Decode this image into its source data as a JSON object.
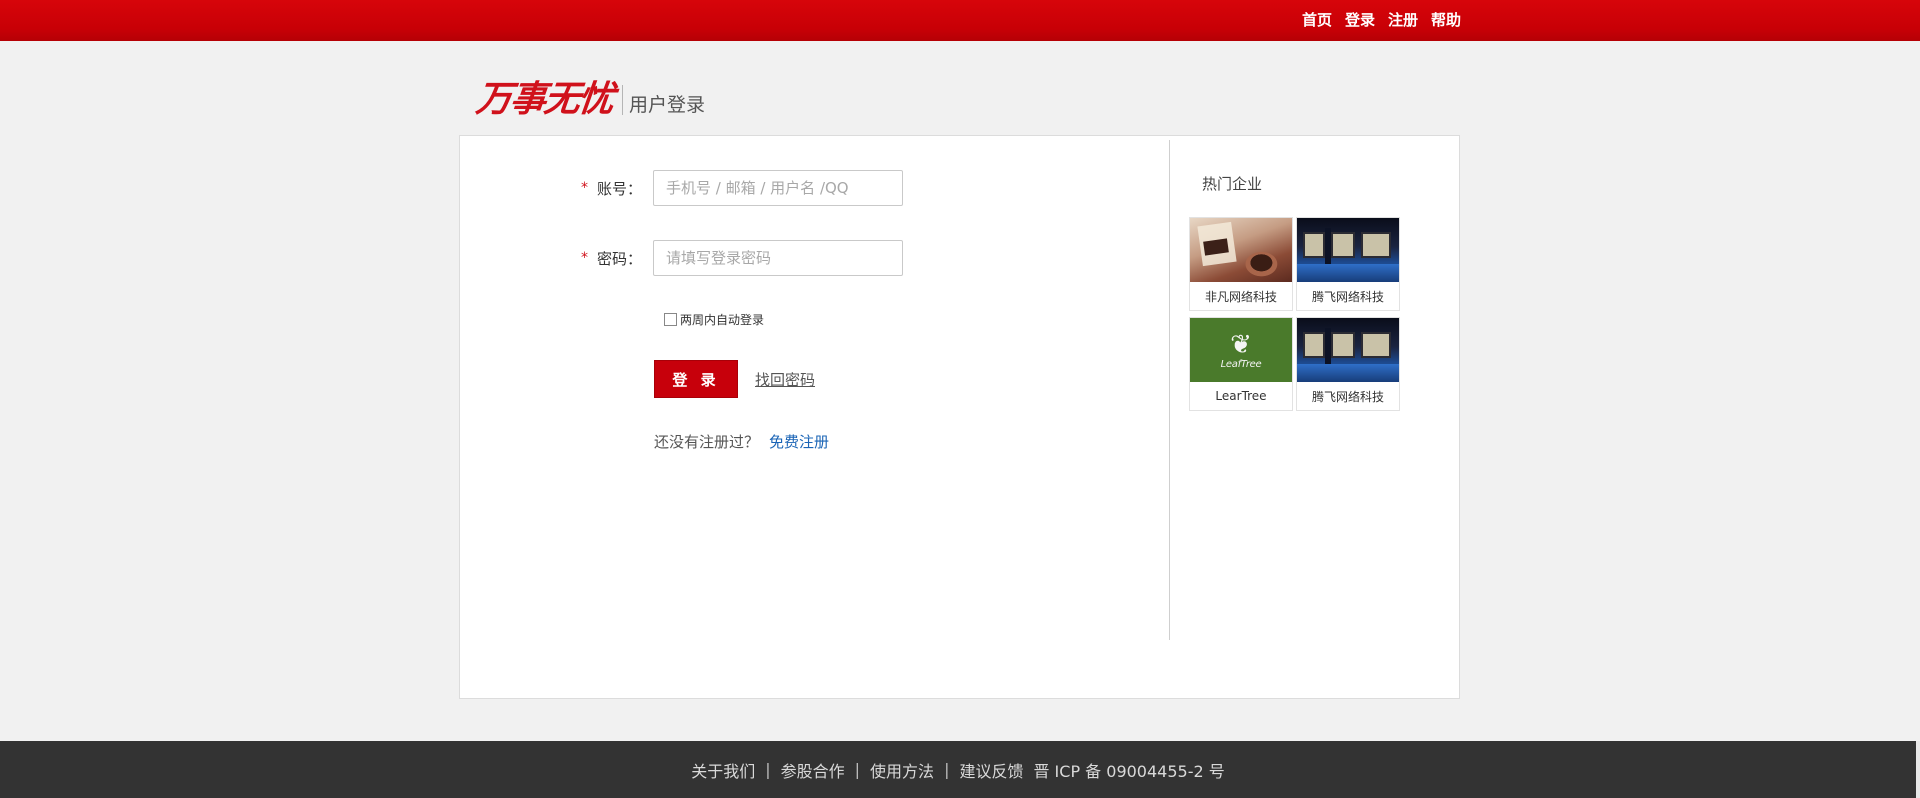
{
  "topnav": {
    "items": [
      "首页",
      "登录",
      "注册",
      "帮助"
    ]
  },
  "brand": {
    "logo_text": "万事无忧",
    "subtitle": "用户登录"
  },
  "login_form": {
    "account_label": "账号：",
    "account_placeholder": "手机号 / 邮箱 / 用户名 /QQ",
    "password_label": "密码：",
    "password_placeholder": "请填写登录密码",
    "required_mark": "*",
    "remember_label": "两周内自动登录",
    "remember_checked": false,
    "login_button": "登 录",
    "forgot_link": "找回密码",
    "register_prompt": "还没有注册过？",
    "register_link": "免费注册"
  },
  "hot_companies": {
    "title": "热门企业",
    "items": [
      {
        "name": "非凡网络科技",
        "thumb": "cafe-photo"
      },
      {
        "name": "腾飞网络科技",
        "thumb": "office-room-photo"
      },
      {
        "name": "LearTree",
        "thumb": "leaftree-logo",
        "logo_text": "LeafTree"
      },
      {
        "name": "腾飞网络科技",
        "thumb": "office-room-photo"
      }
    ]
  },
  "footer": {
    "links": [
      "关于我们",
      "参股合作",
      "使用方法",
      "建议反馈"
    ],
    "icp": "晋 ICP 备 09004455-2 号"
  },
  "colors": {
    "brand_red": "#c7000b",
    "link_blue": "#1a64b6",
    "footer_bg": "#333333"
  }
}
